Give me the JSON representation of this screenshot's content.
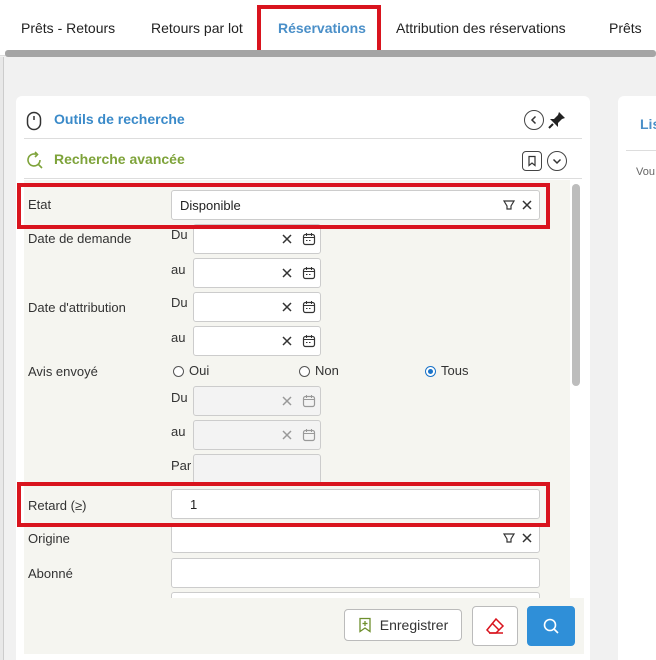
{
  "tabs": [
    {
      "label": "Prêts - Retours",
      "active": false
    },
    {
      "label": "Retours par lot",
      "active": false
    },
    {
      "label": "Réservations",
      "active": true
    },
    {
      "label": "Attribution des réservations",
      "active": false
    },
    {
      "label": "Prêts",
      "active": false
    }
  ],
  "search_tools": {
    "title": "Outils de recherche"
  },
  "advanced": {
    "title": "Recherche avancée"
  },
  "right_panel": {
    "title": "Lis",
    "text": "Vou"
  },
  "form": {
    "etat": {
      "label": "Etat",
      "value": "Disponible"
    },
    "date_demande": {
      "label": "Date de demande",
      "from": "Du",
      "to": "au"
    },
    "date_attribution": {
      "label": "Date d'attribution",
      "from": "Du",
      "to": "au"
    },
    "avis": {
      "label": "Avis envoyé",
      "options": [
        {
          "label": "Oui",
          "selected": false
        },
        {
          "label": "Non",
          "selected": false
        },
        {
          "label": "Tous",
          "selected": true
        }
      ],
      "from": "Du",
      "to": "au",
      "par": "Par"
    },
    "retard": {
      "label": "Retard (≥)",
      "value": "1"
    },
    "origine": {
      "label": "Origine",
      "value": ""
    },
    "abonne": {
      "label": "Abonné",
      "value": ""
    }
  },
  "actions": {
    "save_label": "Enregistrer"
  },
  "colors": {
    "accent_blue": "#3a8ac9",
    "accent_green": "#7ea33a",
    "highlight_red": "#d9141e",
    "search_button": "#2f8fd8"
  }
}
